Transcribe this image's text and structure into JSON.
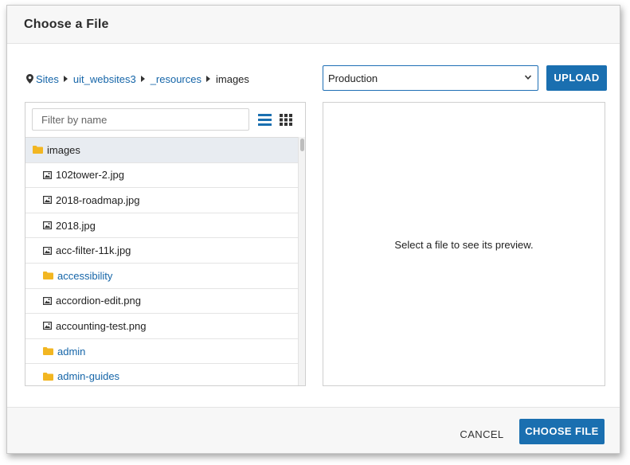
{
  "dialog": {
    "title": "Choose a File"
  },
  "breadcrumb": {
    "icon": "map-pin-icon",
    "items": [
      "Sites",
      "uit_websites3",
      "_resources"
    ],
    "current": "images"
  },
  "server_select": {
    "selected": "Production"
  },
  "upload_button": "UPLOAD",
  "filter": {
    "placeholder": "Filter by name",
    "value": ""
  },
  "view_icons": [
    "list-view-icon",
    "grid-view-icon"
  ],
  "files": [
    {
      "name": "images",
      "type": "folder",
      "level": "root",
      "selected": true
    },
    {
      "name": "102tower-2.jpg",
      "type": "image"
    },
    {
      "name": "2018-roadmap.jpg",
      "type": "image"
    },
    {
      "name": "2018.jpg",
      "type": "image"
    },
    {
      "name": "acc-filter-11k.jpg",
      "type": "image"
    },
    {
      "name": "accessibility",
      "type": "folder"
    },
    {
      "name": "accordion-edit.png",
      "type": "image"
    },
    {
      "name": "accounting-test.png",
      "type": "image"
    },
    {
      "name": "admin",
      "type": "folder"
    },
    {
      "name": "admin-guides",
      "type": "folder"
    }
  ],
  "preview": {
    "message": "Select a file to see its preview."
  },
  "footer": {
    "cancel_label": "CANCEL",
    "choose_label": "CHOOSE FILE"
  },
  "colors": {
    "accent": "#1a6fb0",
    "link": "#1565a8",
    "folder": "#f2b622",
    "selected_row": "#e8ecf1"
  }
}
